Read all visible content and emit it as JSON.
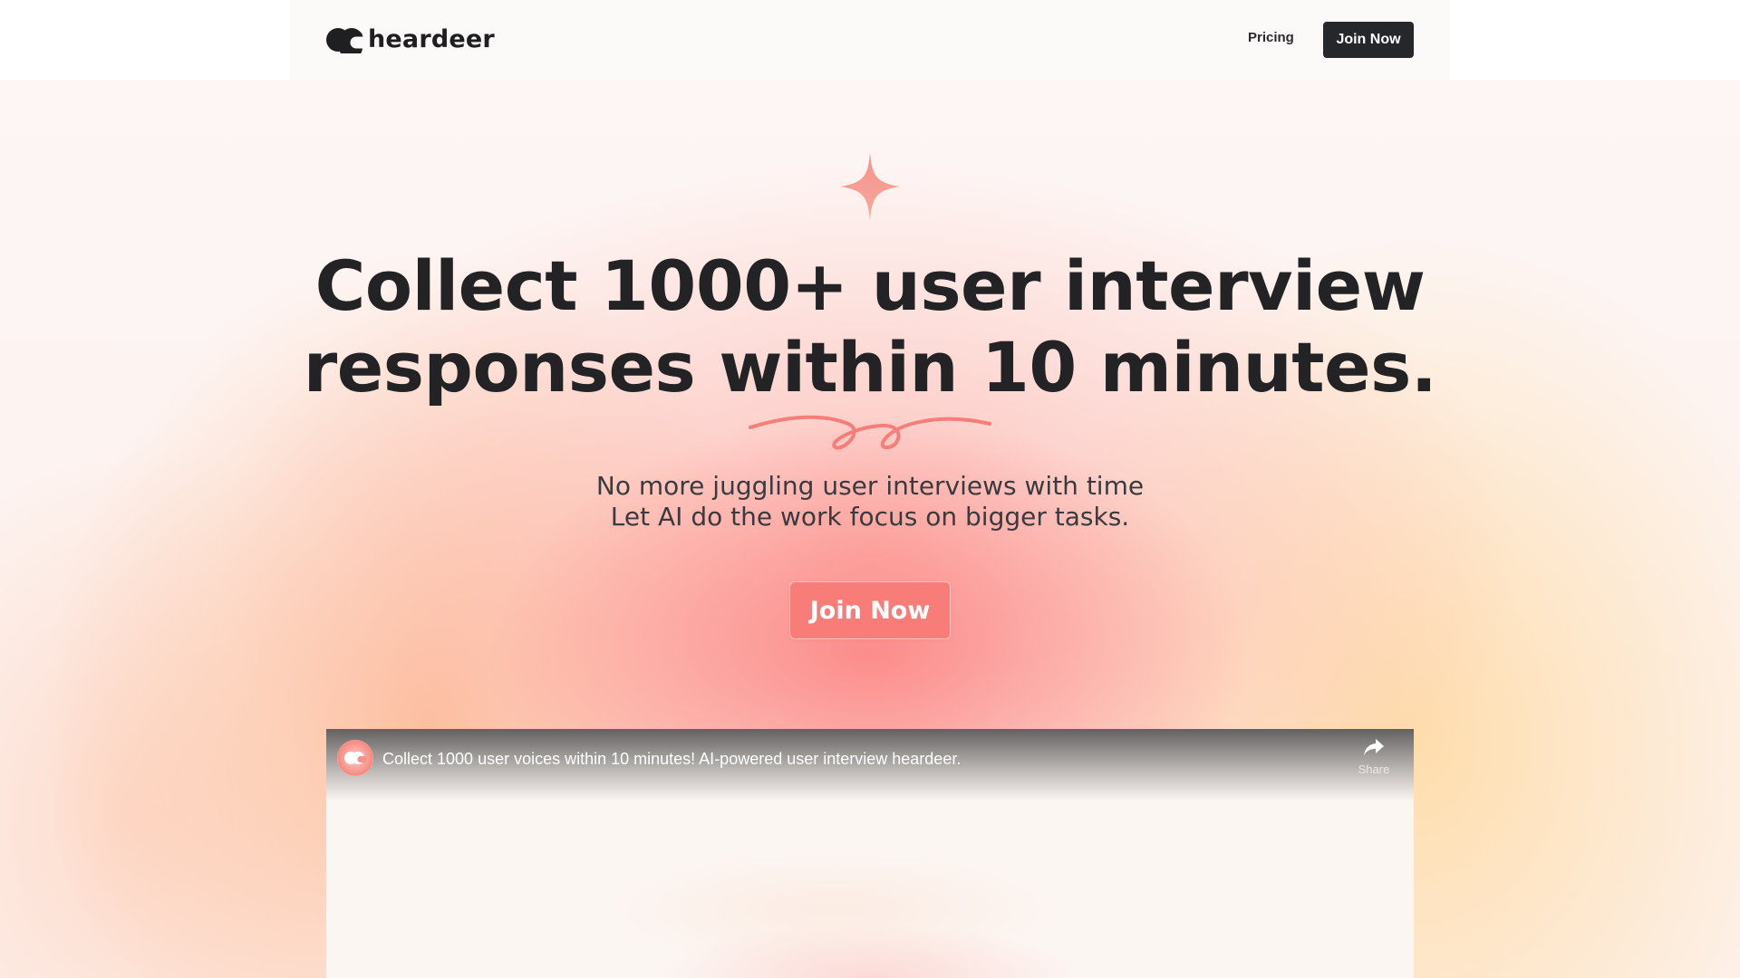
{
  "brand": {
    "name": "heardeer",
    "logo_icon": "heardeer-logo-icon"
  },
  "nav": {
    "pricing_label": "Pricing",
    "join_label": "Join Now"
  },
  "hero": {
    "icon": "sparkle-icon",
    "title_line1": "Collect 1000+ user interview",
    "title_line2": "responses within 10 minutes.",
    "subtitle_line1": "No more juggling user interviews with time",
    "subtitle_line2": "Let AI do the work focus on bigger tasks.",
    "cta_label": "Join Now"
  },
  "video": {
    "title": "Collect 1000 user voices within 10 minutes! AI-powered user interview heardeer.",
    "share_label": "Share",
    "share_icon": "share-arrow-icon"
  },
  "colors": {
    "accent": "#f87c78",
    "dark_button": "#26272a",
    "text": "#232326"
  }
}
